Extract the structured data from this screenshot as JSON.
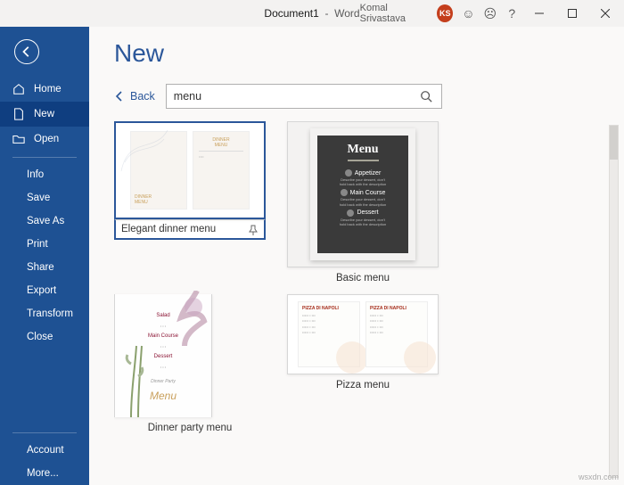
{
  "titlebar": {
    "document": "Document1",
    "app": "Word",
    "user": "Komal Srivastava",
    "initials": "KS"
  },
  "sidebar": {
    "home": "Home",
    "new": "New",
    "open": "Open",
    "info": "Info",
    "save": "Save",
    "saveas": "Save As",
    "print": "Print",
    "share": "Share",
    "export": "Export",
    "transform": "Transform",
    "close": "Close",
    "account": "Account",
    "more": "More..."
  },
  "page": {
    "title": "New",
    "back": "Back"
  },
  "search": {
    "value": "menu"
  },
  "templates": [
    {
      "caption": "Elegant dinner menu"
    },
    {
      "caption": "Basic menu"
    },
    {
      "caption": "Dinner party menu"
    },
    {
      "caption": "Pizza menu"
    }
  ],
  "basic_thumb": {
    "title": "Menu",
    "sec1": "Appetizer",
    "sec2": "Main Course",
    "sec3": "Dessert"
  },
  "party_thumb": {
    "l1": "Salad",
    "l2": "Main Course",
    "l3": "Dessert",
    "menu": "Menu"
  },
  "pizza_thumb": {
    "hdr": "PIZZA DI NAPOLI"
  },
  "watermark": "wsxdn.com"
}
